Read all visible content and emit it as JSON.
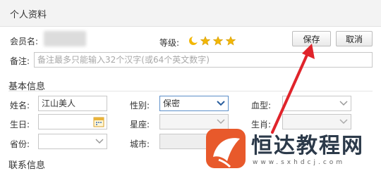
{
  "header": {
    "title": "个人资料"
  },
  "profile": {
    "member_label": "会员名:",
    "level_label": "等级:",
    "note_label": "备注:",
    "note_placeholder": "备注最多只能输入32个汉字(或64个英文数字)",
    "level_icons": [
      "moon-icon",
      "crown-icon",
      "crown-icon",
      "crown-icon"
    ]
  },
  "actions": {
    "save_label": "保存",
    "cancel_label": "取消"
  },
  "basic": {
    "section_title": "基本信息",
    "name_label": "姓名:",
    "name_value": "江山美人",
    "gender_label": "性别:",
    "gender_value": "保密",
    "blood_label": "血型:",
    "birthday_label": "生日:",
    "zodiac_label": "星座:",
    "shengxiao_label": "生肖:",
    "province_label": "省份:",
    "city_label": "城市:"
  },
  "contact": {
    "section_title": "联系信息"
  },
  "watermark": {
    "brand": "恒达教程网",
    "url": "www.sxhdcj.com"
  },
  "colors": {
    "arrow": "#e0242b",
    "star": "#f2b705",
    "select_focus": "#5b8ec8",
    "logo": "#e8592b"
  }
}
